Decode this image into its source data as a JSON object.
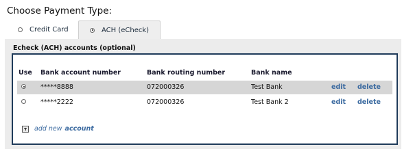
{
  "page": {
    "title": "Choose Payment Type:"
  },
  "tabs": [
    {
      "label": "Credit Card",
      "selected": false
    },
    {
      "label": "ACH (eCheck)",
      "selected": true
    }
  ],
  "panel": {
    "title": "Echeck (ACH) accounts (optional)",
    "headers": {
      "use": "Use",
      "account": "Bank account number",
      "routing": "Bank routing number",
      "bank": "Bank name"
    },
    "rows": [
      {
        "selected": true,
        "account": "*****8888",
        "routing": "072000326",
        "bank": "Test Bank",
        "edit": "edit",
        "delete": "delete"
      },
      {
        "selected": false,
        "account": "*****2222",
        "routing": "072000326",
        "bank": "Test Bank 2",
        "edit": "edit",
        "delete": "delete"
      }
    ],
    "add_link": {
      "prefix": "add new",
      "emphasis": "account"
    }
  },
  "icons": [
    "radio-selected-icon",
    "radio-unselected-icon",
    "plus-icon"
  ]
}
